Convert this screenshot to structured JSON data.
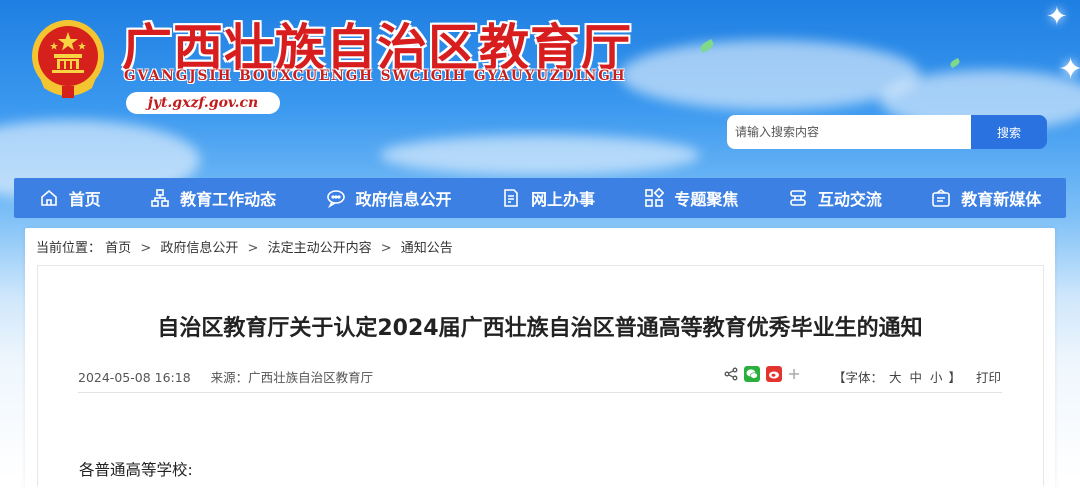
{
  "header": {
    "site_title": "广西壮族自治区教育厅",
    "site_subtitle": "GVANGJSIH BOUXCUENGH SWCIGIH GYAUYUZDINGH",
    "domain": "jyt.gxzf.gov.cn"
  },
  "search": {
    "placeholder": "请输入搜索内容",
    "button_label": "搜索"
  },
  "nav": {
    "items": [
      {
        "label": "首页",
        "icon": "home-icon"
      },
      {
        "label": "教育工作动态",
        "icon": "network-icon"
      },
      {
        "label": "政府信息公开",
        "icon": "chat-icon"
      },
      {
        "label": "网上办事",
        "icon": "document-edit-icon"
      },
      {
        "label": "专题聚焦",
        "icon": "grid-icon"
      },
      {
        "label": "互动交流",
        "icon": "exchange-icon"
      },
      {
        "label": "教育新媒体",
        "icon": "media-icon"
      }
    ]
  },
  "breadcrumb": {
    "prefix": "当前位置：",
    "items": [
      "首页",
      "政府信息公开",
      "法定主动公开内容",
      "通知公告"
    ],
    "separator": ">"
  },
  "article": {
    "title": "自治区教育厅关于认定2024届广西壮族自治区普通高等教育优秀毕业生的通知",
    "datetime": "2024-05-08 16:18",
    "source_label": "来源：",
    "source": "广西壮族自治区教育厅",
    "font_size_label": "【字体：",
    "font_sizes": [
      "大",
      "中",
      "小"
    ],
    "font_size_close": "】",
    "print_label": "打印",
    "salutation": "各普通高等学校:"
  },
  "share": {
    "icons": [
      "share-icon",
      "wechat-icon",
      "weibo-icon",
      "plus-icon"
    ]
  },
  "colors": {
    "title_red": "#d71d1d",
    "nav_blue": "#3c80e4",
    "search_button": "#2a72e0"
  }
}
